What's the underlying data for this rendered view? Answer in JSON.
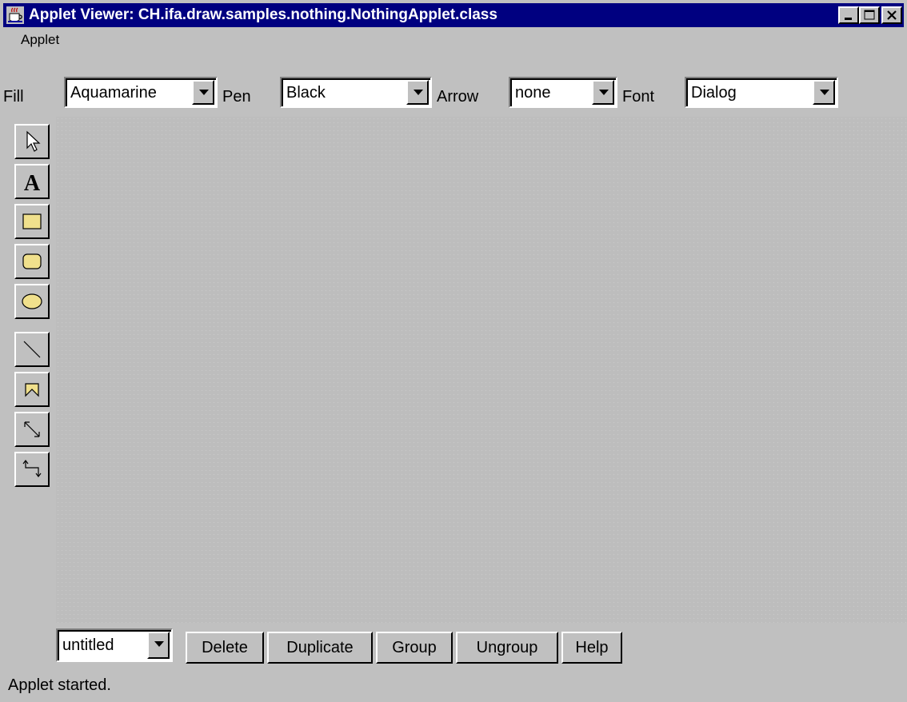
{
  "window": {
    "title": "Applet Viewer: CH.ifa.draw.samples.nothing.NothingApplet.class",
    "controls": [
      "minimize",
      "maximize",
      "close"
    ]
  },
  "menubar": {
    "items": [
      {
        "label": "Applet"
      }
    ]
  },
  "attributes": {
    "fill": {
      "label": "Fill",
      "value": "Aquamarine"
    },
    "pen": {
      "label": "Pen",
      "value": "Black"
    },
    "arrow": {
      "label": "Arrow",
      "value": "none"
    },
    "font": {
      "label": "Font",
      "value": "Dialog"
    }
  },
  "tools": [
    {
      "name": "selection",
      "icon": "arrow-pointer-icon"
    },
    {
      "name": "text",
      "icon": "text-a-icon"
    },
    {
      "name": "rectangle",
      "icon": "rectangle-icon"
    },
    {
      "name": "round-rectangle",
      "icon": "round-rectangle-icon"
    },
    {
      "name": "ellipse",
      "icon": "ellipse-icon"
    },
    {
      "name": "line",
      "icon": "line-icon"
    },
    {
      "name": "polygon",
      "icon": "polygon-icon"
    },
    {
      "name": "connection",
      "icon": "connection-icon"
    },
    {
      "name": "elbow-connection",
      "icon": "elbow-connection-icon"
    }
  ],
  "bottom": {
    "document_choice": "untitled",
    "buttons": {
      "delete": "Delete",
      "duplicate": "Duplicate",
      "group": "Group",
      "ungroup": "Ungroup",
      "help": "Help"
    }
  },
  "status": "Applet started.",
  "colors": {
    "titlebar": "#000080",
    "face": "#c0c0c0",
    "canvas": "#bdbdbd",
    "tool_fill": "#f0e08c"
  }
}
